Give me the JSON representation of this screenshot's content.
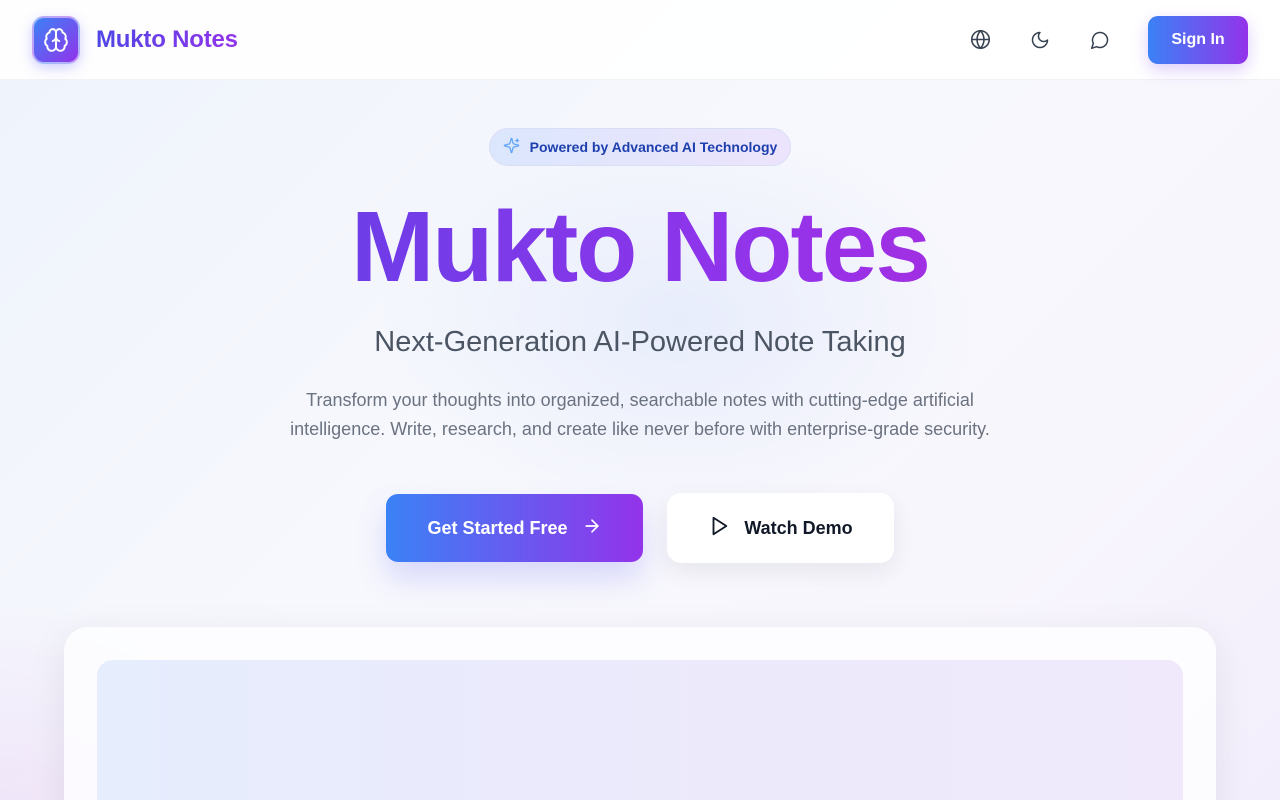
{
  "header": {
    "brand_name": "Mukto Notes",
    "icons": [
      "brain-icon",
      "globe-icon",
      "moon-icon",
      "chat-icon"
    ],
    "sign_in_label": "Sign In"
  },
  "hero": {
    "badge_text": "Powered by Advanced AI Technology",
    "badge_icon": "sparkles-icon",
    "title": "Mukto Notes",
    "subtitle": "Next-Generation AI-Powered Note Taking",
    "description": "Transform your thoughts into organized, searchable notes with cutting-edge artificial intelligence. Write, research, and create like never before with enterprise-grade security.",
    "primary_cta_label": "Get Started Free",
    "primary_cta_icon": "arrow-right-icon",
    "secondary_cta_label": "Watch Demo",
    "secondary_cta_icon": "play-icon"
  },
  "colors": {
    "gradient_start": "#3b82f6",
    "gradient_end": "#9333ea",
    "title_start": "#4f46e5",
    "title_end": "#c026d3",
    "badge_text": "#1e40af",
    "body_text": "#6b7280"
  }
}
